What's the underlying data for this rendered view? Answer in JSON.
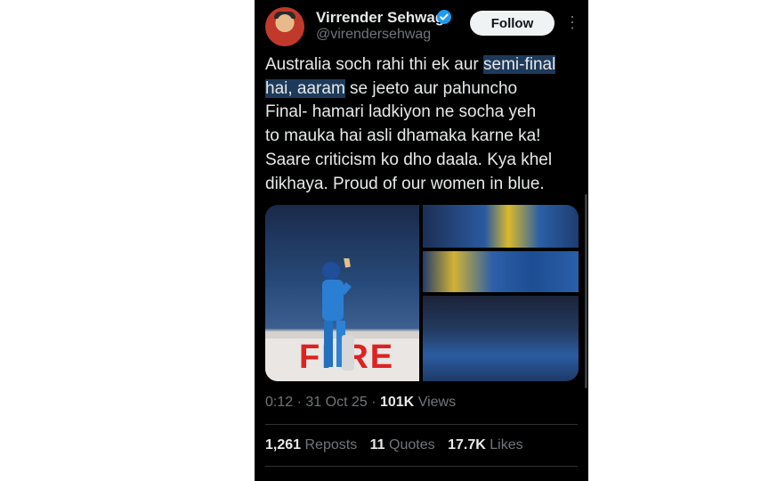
{
  "author": {
    "name": "Virrender Sehwag",
    "handle": "@virendersehwag",
    "follow_label": "Follow",
    "verified_badge": "verified-check-icon"
  },
  "tweet": {
    "lines": [
      {
        "pre": "Australia soch rahi thi ek aur ",
        "hl": "semi-final"
      },
      {
        "hl": "hai, aaram",
        "post": " se jeeto aur pahuncho"
      },
      {
        "text": "Final- hamari ladkiyon ne socha yeh"
      },
      {
        "text": "to mauka hai asli dhamaka karne ka!"
      },
      {
        "text": "Saare criticism ko dho daala. Kya khel"
      },
      {
        "text": "dikhaya. Proud of our women in blue."
      }
    ],
    "media_banner_text": "FI RE"
  },
  "meta": {
    "time": "0:12",
    "date": "31 Oct 25",
    "views_count": "101K",
    "views_label": "Views",
    "separator": "·"
  },
  "stats": {
    "reposts_count": "1,261",
    "reposts_label": "Reposts",
    "quotes_count": "11",
    "quotes_label": "Quotes",
    "likes_count": "17.7K",
    "likes_label": "Likes"
  },
  "colors": {
    "background": "#000000",
    "text": "#e7e9ea",
    "muted": "#71767b",
    "highlight": "#1e3a5a",
    "verified": "#1d9bf0"
  }
}
